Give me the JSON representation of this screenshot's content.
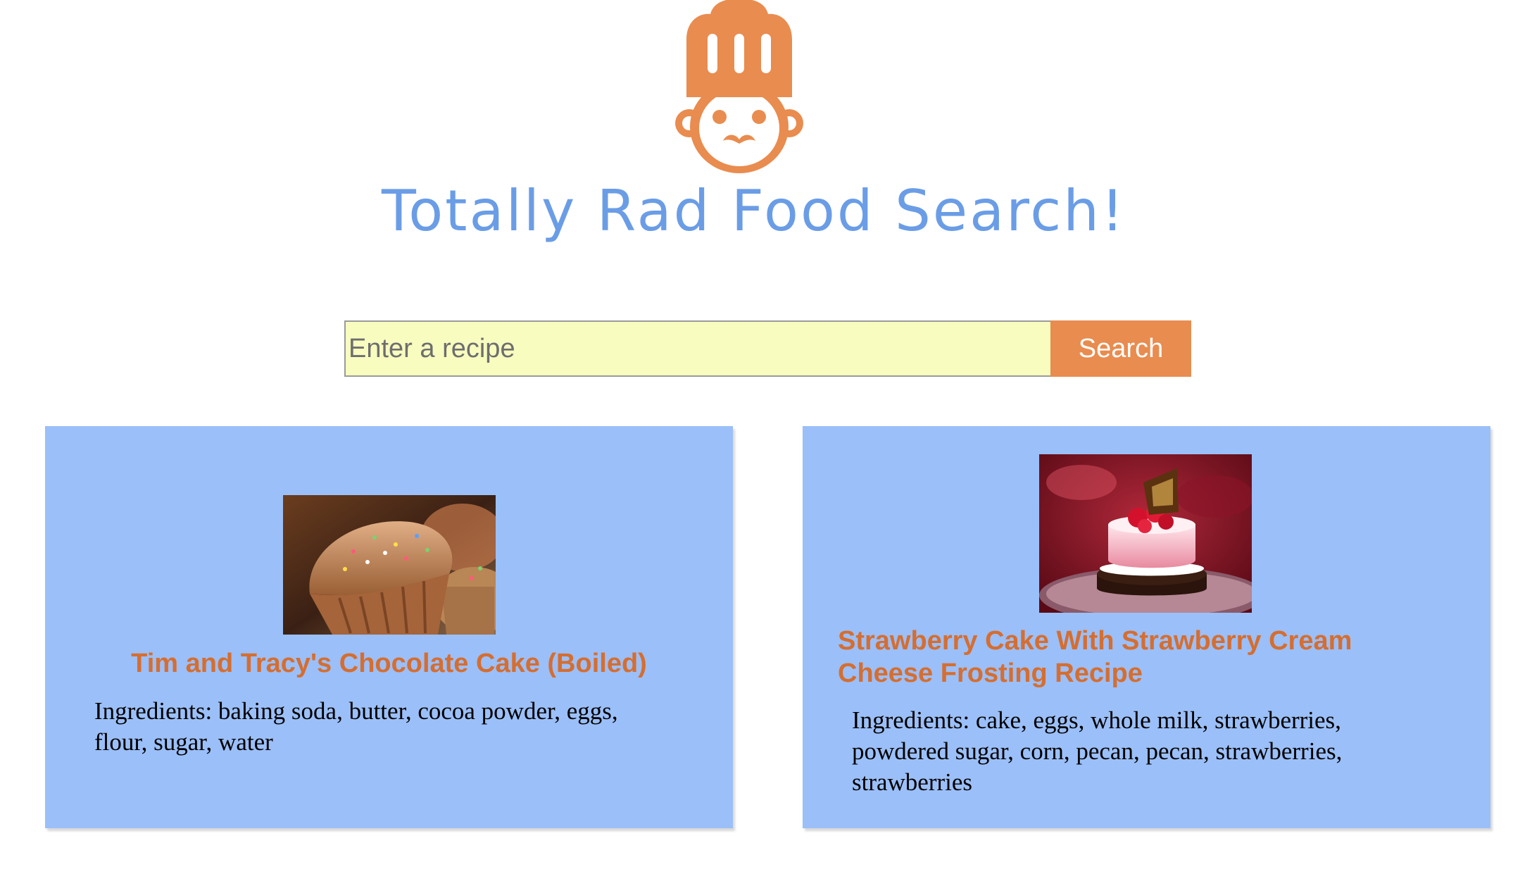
{
  "header": {
    "logo_icon": "chef-hat-icon",
    "title": "Totally Rad Food Search!",
    "title_color": "#6b9de6",
    "logo_color": "#e98c4f"
  },
  "search": {
    "placeholder": "Enter a recipe",
    "value": "",
    "button_label": "Search",
    "input_background": "#f8fcbf",
    "button_color": "#e98c4f"
  },
  "results": [
    {
      "image": "muffin-photo",
      "title": "Tim and Tracy's Chocolate Cake (Boiled)",
      "ingredients": "Ingredients: baking soda, butter, cocoa powder, eggs, flour, sugar, water"
    },
    {
      "image": "strawberry-cake-photo",
      "title": "Strawberry Cake With Strawberry Cream Cheese Frosting Recipe",
      "ingredients": "Ingredients: cake, eggs, whole milk, strawberries, powdered sugar, corn, pecan, pecan, strawberries, strawberries"
    }
  ],
  "card_background": "#9bbff8",
  "card_title_color": "#d56e30"
}
